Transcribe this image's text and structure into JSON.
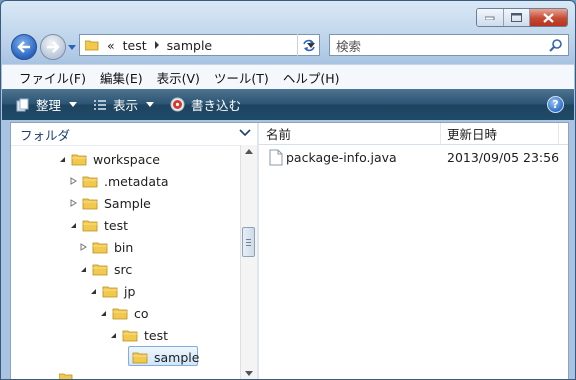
{
  "window": {
    "caption_buttons": [
      "minimize",
      "maximize",
      "close"
    ]
  },
  "address_bar": {
    "overflow": "«",
    "crumbs": [
      "test",
      "sample"
    ]
  },
  "search": {
    "placeholder": "検索"
  },
  "menu": [
    "ファイル(F)",
    "編集(E)",
    "表示(V)",
    "ツール(T)",
    "ヘルプ(H)"
  ],
  "toolbar": {
    "organize": "整理",
    "views": "表示",
    "burn": "書き込む",
    "help": "?"
  },
  "nav_pane": {
    "header": "フォルダ",
    "tree": [
      {
        "label": "workspace",
        "level": 0,
        "expanded": true
      },
      {
        "label": ".metadata",
        "level": 1,
        "expanded": false
      },
      {
        "label": "Sample",
        "level": 1,
        "expanded": false
      },
      {
        "label": "test",
        "level": 1,
        "expanded": true
      },
      {
        "label": "bin",
        "level": 2,
        "expanded": false
      },
      {
        "label": "src",
        "level": 2,
        "expanded": true
      },
      {
        "label": "jp",
        "level": 3,
        "expanded": true
      },
      {
        "label": "co",
        "level": 4,
        "expanded": true
      },
      {
        "label": "test",
        "level": 5,
        "expanded": true
      },
      {
        "label": "sample",
        "level": 6,
        "selected": true
      }
    ]
  },
  "file_list": {
    "columns": [
      "名前",
      "更新日時"
    ],
    "rows": [
      {
        "name": "package-info.java",
        "modified": "2013/09/05 23:56"
      }
    ]
  },
  "colors": {
    "accent": "#2b5573",
    "selection": "#cfe6fb",
    "folder": "#f2c94c"
  }
}
